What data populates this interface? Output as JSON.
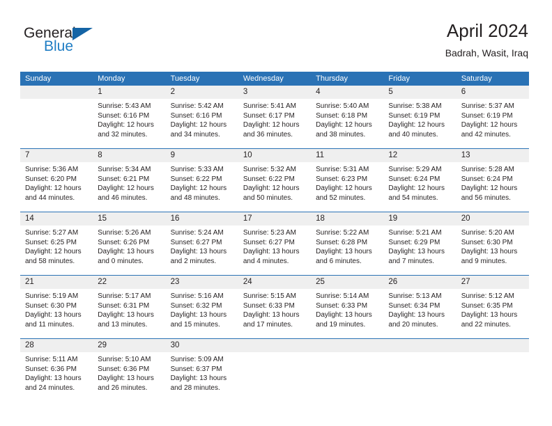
{
  "brand": {
    "word1": "General",
    "word2": "Blue",
    "logo_icon": "triangle-logo-icon",
    "accent_color": "#1f7dc4",
    "triangle_color": "#1464a5"
  },
  "header": {
    "title": "April 2024",
    "location": "Badrah, Wasit, Iraq"
  },
  "calendar": {
    "header_bg": "#2a72b5",
    "daynum_bg": "#efefef",
    "weekdays": [
      "Sunday",
      "Monday",
      "Tuesday",
      "Wednesday",
      "Thursday",
      "Friday",
      "Saturday"
    ],
    "weeks": [
      [
        {
          "day": "",
          "sunrise": "",
          "sunset": "",
          "daylight_line1": "",
          "daylight_line2": ""
        },
        {
          "day": "1",
          "sunrise": "Sunrise: 5:43 AM",
          "sunset": "Sunset: 6:16 PM",
          "daylight_line1": "Daylight: 12 hours",
          "daylight_line2": "and 32 minutes."
        },
        {
          "day": "2",
          "sunrise": "Sunrise: 5:42 AM",
          "sunset": "Sunset: 6:16 PM",
          "daylight_line1": "Daylight: 12 hours",
          "daylight_line2": "and 34 minutes."
        },
        {
          "day": "3",
          "sunrise": "Sunrise: 5:41 AM",
          "sunset": "Sunset: 6:17 PM",
          "daylight_line1": "Daylight: 12 hours",
          "daylight_line2": "and 36 minutes."
        },
        {
          "day": "4",
          "sunrise": "Sunrise: 5:40 AM",
          "sunset": "Sunset: 6:18 PM",
          "daylight_line1": "Daylight: 12 hours",
          "daylight_line2": "and 38 minutes."
        },
        {
          "day": "5",
          "sunrise": "Sunrise: 5:38 AM",
          "sunset": "Sunset: 6:19 PM",
          "daylight_line1": "Daylight: 12 hours",
          "daylight_line2": "and 40 minutes."
        },
        {
          "day": "6",
          "sunrise": "Sunrise: 5:37 AM",
          "sunset": "Sunset: 6:19 PM",
          "daylight_line1": "Daylight: 12 hours",
          "daylight_line2": "and 42 minutes."
        }
      ],
      [
        {
          "day": "7",
          "sunrise": "Sunrise: 5:36 AM",
          "sunset": "Sunset: 6:20 PM",
          "daylight_line1": "Daylight: 12 hours",
          "daylight_line2": "and 44 minutes."
        },
        {
          "day": "8",
          "sunrise": "Sunrise: 5:34 AM",
          "sunset": "Sunset: 6:21 PM",
          "daylight_line1": "Daylight: 12 hours",
          "daylight_line2": "and 46 minutes."
        },
        {
          "day": "9",
          "sunrise": "Sunrise: 5:33 AM",
          "sunset": "Sunset: 6:22 PM",
          "daylight_line1": "Daylight: 12 hours",
          "daylight_line2": "and 48 minutes."
        },
        {
          "day": "10",
          "sunrise": "Sunrise: 5:32 AM",
          "sunset": "Sunset: 6:22 PM",
          "daylight_line1": "Daylight: 12 hours",
          "daylight_line2": "and 50 minutes."
        },
        {
          "day": "11",
          "sunrise": "Sunrise: 5:31 AM",
          "sunset": "Sunset: 6:23 PM",
          "daylight_line1": "Daylight: 12 hours",
          "daylight_line2": "and 52 minutes."
        },
        {
          "day": "12",
          "sunrise": "Sunrise: 5:29 AM",
          "sunset": "Sunset: 6:24 PM",
          "daylight_line1": "Daylight: 12 hours",
          "daylight_line2": "and 54 minutes."
        },
        {
          "day": "13",
          "sunrise": "Sunrise: 5:28 AM",
          "sunset": "Sunset: 6:24 PM",
          "daylight_line1": "Daylight: 12 hours",
          "daylight_line2": "and 56 minutes."
        }
      ],
      [
        {
          "day": "14",
          "sunrise": "Sunrise: 5:27 AM",
          "sunset": "Sunset: 6:25 PM",
          "daylight_line1": "Daylight: 12 hours",
          "daylight_line2": "and 58 minutes."
        },
        {
          "day": "15",
          "sunrise": "Sunrise: 5:26 AM",
          "sunset": "Sunset: 6:26 PM",
          "daylight_line1": "Daylight: 13 hours",
          "daylight_line2": "and 0 minutes."
        },
        {
          "day": "16",
          "sunrise": "Sunrise: 5:24 AM",
          "sunset": "Sunset: 6:27 PM",
          "daylight_line1": "Daylight: 13 hours",
          "daylight_line2": "and 2 minutes."
        },
        {
          "day": "17",
          "sunrise": "Sunrise: 5:23 AM",
          "sunset": "Sunset: 6:27 PM",
          "daylight_line1": "Daylight: 13 hours",
          "daylight_line2": "and 4 minutes."
        },
        {
          "day": "18",
          "sunrise": "Sunrise: 5:22 AM",
          "sunset": "Sunset: 6:28 PM",
          "daylight_line1": "Daylight: 13 hours",
          "daylight_line2": "and 6 minutes."
        },
        {
          "day": "19",
          "sunrise": "Sunrise: 5:21 AM",
          "sunset": "Sunset: 6:29 PM",
          "daylight_line1": "Daylight: 13 hours",
          "daylight_line2": "and 7 minutes."
        },
        {
          "day": "20",
          "sunrise": "Sunrise: 5:20 AM",
          "sunset": "Sunset: 6:30 PM",
          "daylight_line1": "Daylight: 13 hours",
          "daylight_line2": "and 9 minutes."
        }
      ],
      [
        {
          "day": "21",
          "sunrise": "Sunrise: 5:19 AM",
          "sunset": "Sunset: 6:30 PM",
          "daylight_line1": "Daylight: 13 hours",
          "daylight_line2": "and 11 minutes."
        },
        {
          "day": "22",
          "sunrise": "Sunrise: 5:17 AM",
          "sunset": "Sunset: 6:31 PM",
          "daylight_line1": "Daylight: 13 hours",
          "daylight_line2": "and 13 minutes."
        },
        {
          "day": "23",
          "sunrise": "Sunrise: 5:16 AM",
          "sunset": "Sunset: 6:32 PM",
          "daylight_line1": "Daylight: 13 hours",
          "daylight_line2": "and 15 minutes."
        },
        {
          "day": "24",
          "sunrise": "Sunrise: 5:15 AM",
          "sunset": "Sunset: 6:33 PM",
          "daylight_line1": "Daylight: 13 hours",
          "daylight_line2": "and 17 minutes."
        },
        {
          "day": "25",
          "sunrise": "Sunrise: 5:14 AM",
          "sunset": "Sunset: 6:33 PM",
          "daylight_line1": "Daylight: 13 hours",
          "daylight_line2": "and 19 minutes."
        },
        {
          "day": "26",
          "sunrise": "Sunrise: 5:13 AM",
          "sunset": "Sunset: 6:34 PM",
          "daylight_line1": "Daylight: 13 hours",
          "daylight_line2": "and 20 minutes."
        },
        {
          "day": "27",
          "sunrise": "Sunrise: 5:12 AM",
          "sunset": "Sunset: 6:35 PM",
          "daylight_line1": "Daylight: 13 hours",
          "daylight_line2": "and 22 minutes."
        }
      ],
      [
        {
          "day": "28",
          "sunrise": "Sunrise: 5:11 AM",
          "sunset": "Sunset: 6:36 PM",
          "daylight_line1": "Daylight: 13 hours",
          "daylight_line2": "and 24 minutes."
        },
        {
          "day": "29",
          "sunrise": "Sunrise: 5:10 AM",
          "sunset": "Sunset: 6:36 PM",
          "daylight_line1": "Daylight: 13 hours",
          "daylight_line2": "and 26 minutes."
        },
        {
          "day": "30",
          "sunrise": "Sunrise: 5:09 AM",
          "sunset": "Sunset: 6:37 PM",
          "daylight_line1": "Daylight: 13 hours",
          "daylight_line2": "and 28 minutes."
        },
        {
          "day": "",
          "sunrise": "",
          "sunset": "",
          "daylight_line1": "",
          "daylight_line2": ""
        },
        {
          "day": "",
          "sunrise": "",
          "sunset": "",
          "daylight_line1": "",
          "daylight_line2": ""
        },
        {
          "day": "",
          "sunrise": "",
          "sunset": "",
          "daylight_line1": "",
          "daylight_line2": ""
        },
        {
          "day": "",
          "sunrise": "",
          "sunset": "",
          "daylight_line1": "",
          "daylight_line2": ""
        }
      ]
    ]
  }
}
